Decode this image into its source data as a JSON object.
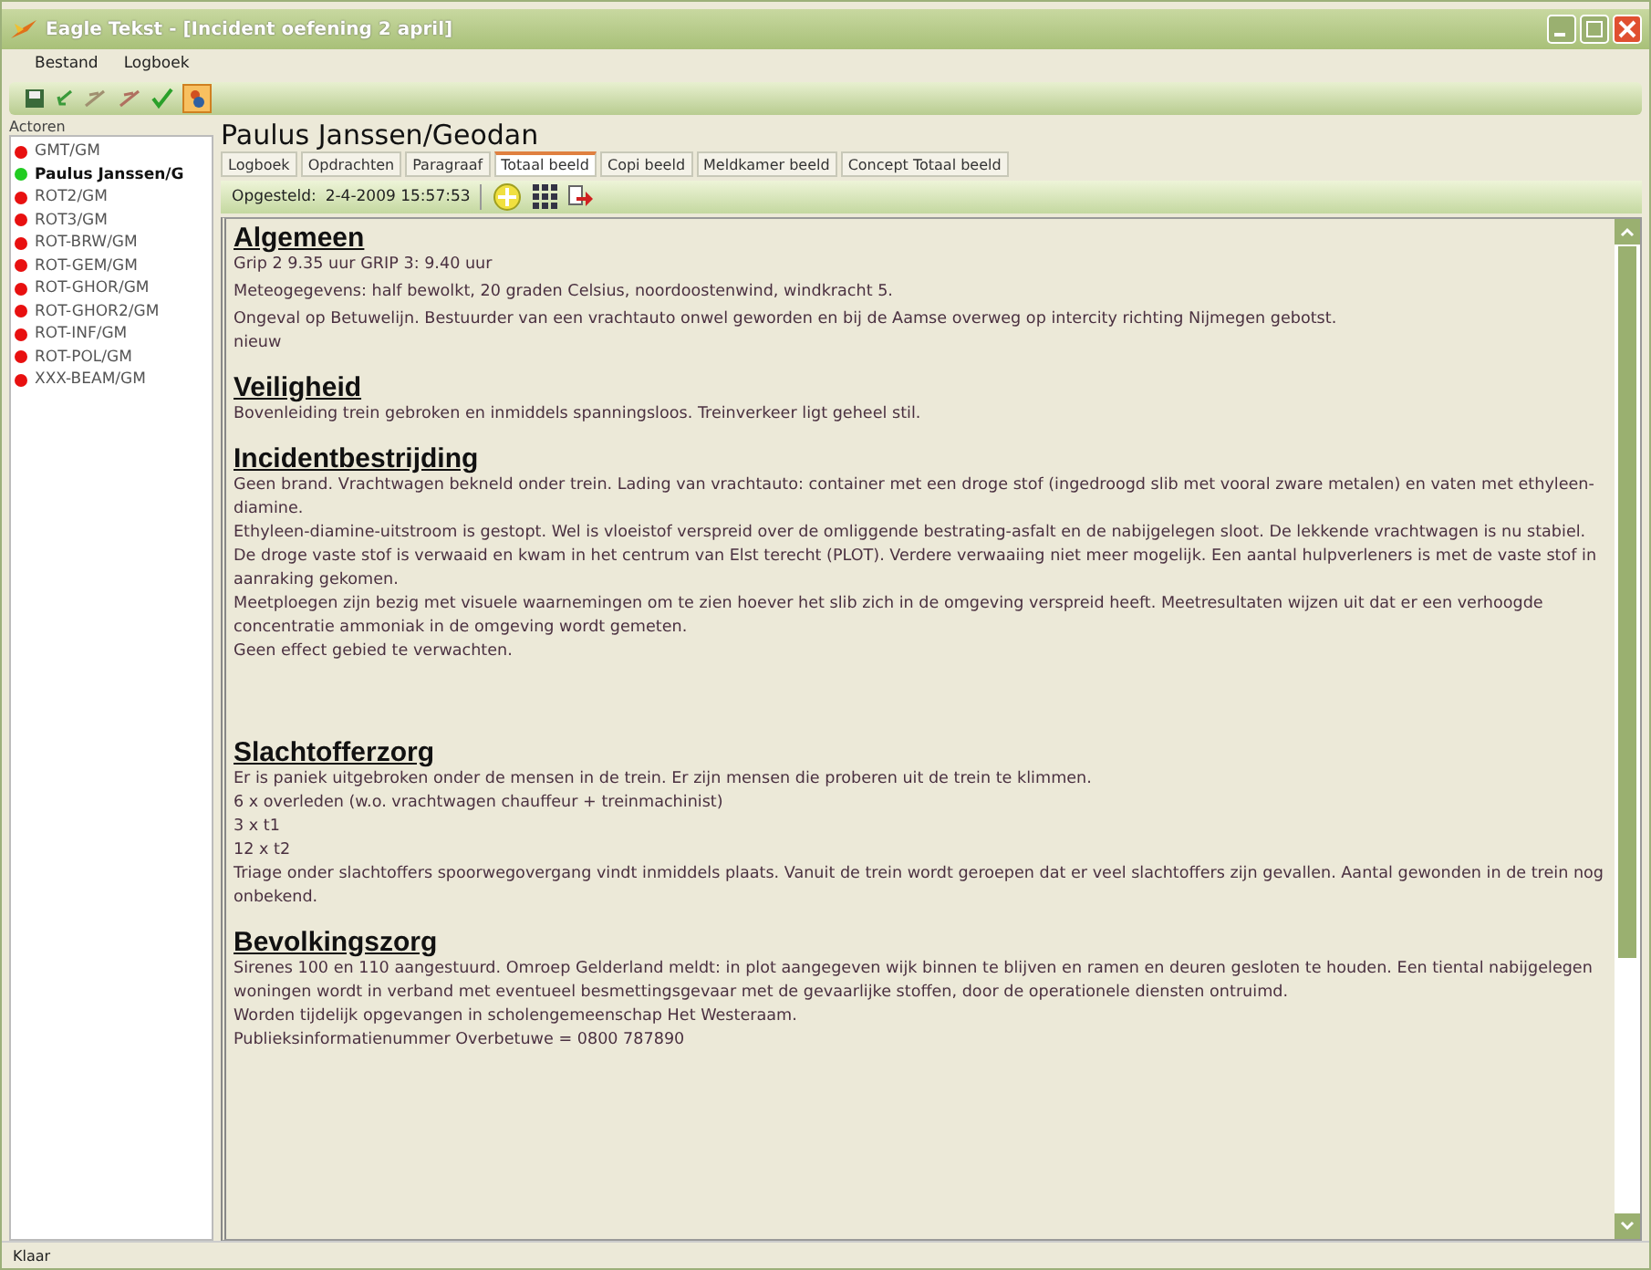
{
  "window": {
    "title": "Eagle Tekst - [Incident oefening 2 april]"
  },
  "menu": [
    "Bestand",
    "Logboek"
  ],
  "sidebar": {
    "title": "Actoren",
    "items": [
      {
        "label": "GMT/GM",
        "color": "#e81010",
        "selected": false
      },
      {
        "label": "Paulus Janssen/G",
        "color": "#22cc22",
        "selected": true
      },
      {
        "label": "ROT2/GM",
        "color": "#e81010",
        "selected": false
      },
      {
        "label": "ROT3/GM",
        "color": "#e81010",
        "selected": false
      },
      {
        "label": "ROT-BRW/GM",
        "color": "#e81010",
        "selected": false
      },
      {
        "label": "ROT-GEM/GM",
        "color": "#e81010",
        "selected": false
      },
      {
        "label": "ROT-GHOR/GM",
        "color": "#e81010",
        "selected": false
      },
      {
        "label": "ROT-GHOR2/GM",
        "color": "#e81010",
        "selected": false
      },
      {
        "label": "ROT-INF/GM",
        "color": "#e81010",
        "selected": false
      },
      {
        "label": "ROT-POL/GM",
        "color": "#e81010",
        "selected": false
      },
      {
        "label": "XXX-BEAM/GM",
        "color": "#e81010",
        "selected": false
      }
    ]
  },
  "panel_title": "Paulus Janssen/Geodan",
  "tabs": [
    {
      "label": "Logboek",
      "selected": false
    },
    {
      "label": "Opdrachten",
      "selected": false
    },
    {
      "label": "Paragraaf",
      "selected": false
    },
    {
      "label": "Totaal beeld",
      "selected": true
    },
    {
      "label": "Copi beeld",
      "selected": false
    },
    {
      "label": "Meldkamer beeld",
      "selected": false
    },
    {
      "label": "Concept Totaal beeld",
      "selected": false
    }
  ],
  "info_bar": {
    "label": "Opgesteld:",
    "value": "2-4-2009 15:57:53"
  },
  "sections": [
    {
      "heading": "Algemeen",
      "lines": [
        "Grip 2 9.35 uur GRIP 3: 9.40 uur",
        "Meteogegevens: half bewolkt, 20 graden Celsius, noordoostenwind, windkracht 5.",
        "Ongeval op Betuwelijn. Bestuurder van een vrachtauto onwel geworden en bij de Aamse overweg op intercity richting Nijmegen gebotst.\nnieuw"
      ]
    },
    {
      "heading": "Veiligheid",
      "lines": [
        "Bovenleiding trein gebroken en inmiddels spanningsloos. Treinverkeer ligt geheel stil."
      ]
    },
    {
      "heading": "Incidentbestrijding",
      "lines": [
        "Geen brand. Vrachtwagen bekneld onder trein. Lading van vrachtauto: container met een droge stof (ingedroogd slib met vooral zware metalen) en vaten met ethyleen-diamine.\nEthyleen-diamine-uitstroom is gestopt. Wel is  vloeistof verspreid over de omliggende bestrating-asfalt en de nabijgelegen sloot. De lekkende vrachtwagen is nu stabiel.\nDe droge vaste stof is verwaaid en kwam in het centrum van Elst terecht (PLOT). Verdere verwaaiing niet meer mogelijk. Een aantal hulpverleners is met de vaste stof in aanraking gekomen.\nMeetploegen zijn bezig met visuele waarnemingen om te zien hoever het slib zich in de omgeving verspreid heeft. Meetresultaten wijzen uit dat er een verhoogde concentratie ammoniak in de omgeving wordt gemeten.\nGeen effect gebied te verwachten."
      ]
    },
    {
      "heading": "Slachtofferzorg",
      "lines": [
        "Er is paniek uitgebroken onder de mensen in de trein. Er zijn mensen die proberen uit de trein te klimmen.\n6 x overleden (w.o. vrachtwagen chauffeur + treinmachinist)\n3 x t1\n12 x t2\nTriage onder slachtoffers spoorwegovergang vindt inmiddels plaats. Vanuit de trein wordt geroepen dat er veel slachtoffers zijn gevallen. Aantal gewonden in de trein nog onbekend."
      ]
    },
    {
      "heading": "Bevolkingszorg",
      "lines": [
        "Sirenes 100 en 110 aangestuurd. Omroep Gelderland meldt: in plot aangegeven wijk binnen te blijven en ramen en deuren gesloten te houden. Een tiental nabijgelegen woningen wordt in verband met eventueel besmettingsgevaar met de gevaarlijke stoffen, door de operationele diensten ontruimd.\nWorden tijdelijk opgevangen in scholengemeenschap Het Westeraam.\nPublieksinformatienummer Overbetuwe = 0800 787890"
      ]
    }
  ],
  "status_bar": "Klaar"
}
